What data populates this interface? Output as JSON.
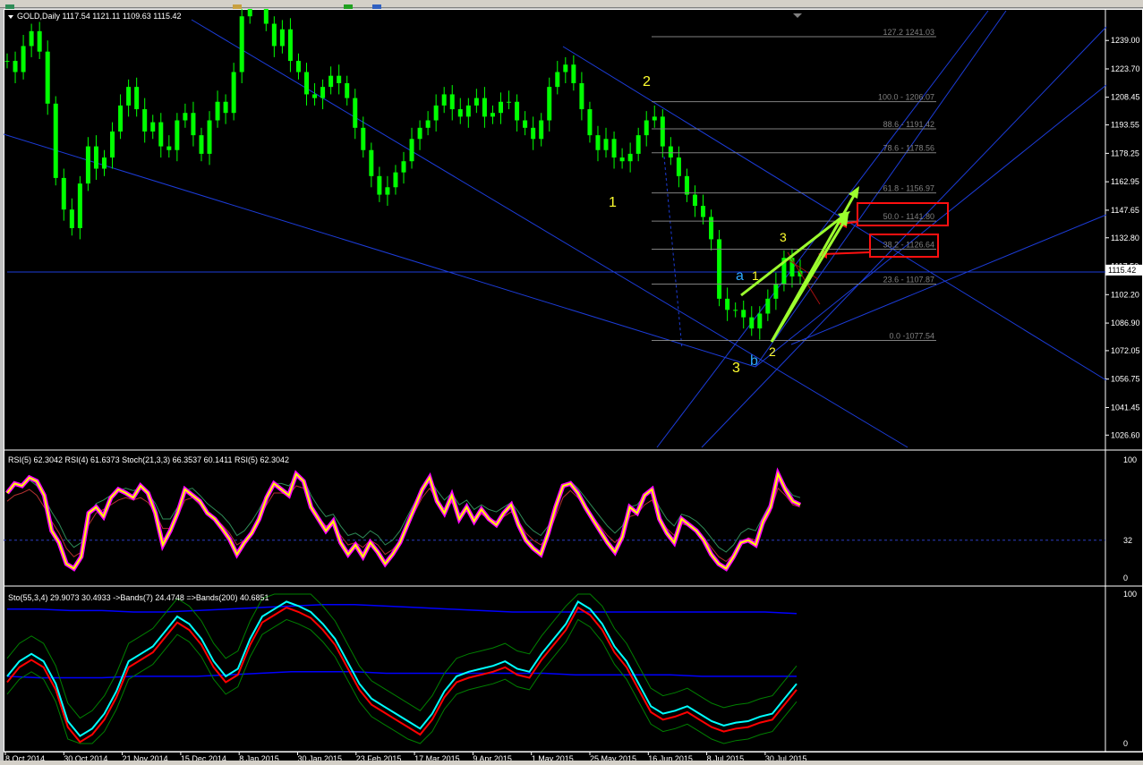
{
  "window": {
    "ohlc_header": "GOLD,Daily  1117.54 1121.11 1109.63 1115.42",
    "current_price": "1115.42"
  },
  "colors": {
    "background": "#000000",
    "candles": "#00ff00",
    "grid_line": "#1c3cd8",
    "fib_line": "#808080",
    "fib_text": "#808080",
    "elliott_yellow": "#ffff30",
    "elliott_blue": "#2ea8ff",
    "arrow_green": "#9cff2e",
    "arrow_red": "#ff1010",
    "rsi_yellow": "#ffff00",
    "rsi_magenta": "#ff00ff",
    "sto_cyan": "#00ffff",
    "sto_red": "#ff0000",
    "band_blue": "#0000ff",
    "band_green": "#008000"
  },
  "toolbar": {
    "icons": [
      "new-chart-icon",
      "zoom-icon",
      "add-icon",
      "globe-icon"
    ]
  },
  "chart_data": [
    {
      "type": "candlestick",
      "symbol": "GOLD",
      "timeframe": "Daily",
      "y_axis_ticks": [
        "1239.00",
        "1223.70",
        "1208.45",
        "1193.55",
        "1178.25",
        "1162.95",
        "1147.65",
        "1132.80",
        "1117.50",
        "1102.20",
        "1086.90",
        "1072.05",
        "1056.75",
        "1041.45",
        "1026.60"
      ],
      "ylim": [
        1020,
        1255
      ],
      "close_path": [
        1228,
        1222,
        1236,
        1244,
        1233,
        1205,
        1165,
        1148,
        1138,
        1162,
        1182,
        1170,
        1176,
        1190,
        1204,
        1214,
        1202,
        1190,
        1195,
        1182,
        1180,
        1196,
        1200,
        1188,
        1178,
        1196,
        1206,
        1200,
        1222,
        1252,
        1272,
        1264,
        1248,
        1236,
        1245,
        1228,
        1222,
        1210,
        1208,
        1214,
        1220,
        1216,
        1208,
        1192,
        1180,
        1166,
        1156,
        1160,
        1168,
        1174,
        1186,
        1192,
        1196,
        1204,
        1210,
        1202,
        1198,
        1204,
        1208,
        1198,
        1200,
        1206,
        1206,
        1196,
        1192,
        1186,
        1196,
        1214,
        1222,
        1226,
        1216,
        1202,
        1188,
        1180,
        1186,
        1176,
        1174,
        1178,
        1188,
        1196,
        1198,
        1182,
        1176,
        1166,
        1156,
        1150,
        1144,
        1132,
        1100,
        1094,
        1094,
        1090,
        1084,
        1092,
        1100,
        1108,
        1122,
        1112,
        1115
      ],
      "fibonacci": [
        {
          "level": "127.2",
          "price": "1241.03",
          "label": "127.2  1241.03"
        },
        {
          "level": "100.0",
          "price": "1206.07",
          "label": "100.0 - 1206.07"
        },
        {
          "level": "88.6",
          "price": "1191.42",
          "label": "88.6 - 1191.42"
        },
        {
          "level": "78.6",
          "price": "1178.56",
          "label": "78.6 - 1178.56"
        },
        {
          "level": "61.8",
          "price": "1156.97",
          "label": "61.8 - 1156.97"
        },
        {
          "level": "50.0",
          "price": "1141.80",
          "label": "50.0 - 1141.80"
        },
        {
          "level": "38.2",
          "price": "1126.64",
          "label": "38.2 - 1126.64"
        },
        {
          "level": "23.6",
          "price": "1107.87",
          "label": "23.6 - 1107.87"
        },
        {
          "level": "0.0",
          "price": "1077.54",
          "label": "0.0 -1077.54"
        }
      ],
      "wave_labels": [
        {
          "text": "2",
          "color": "yellow"
        },
        {
          "text": "1",
          "color": "yellow"
        },
        {
          "text": "3",
          "color": "yellow"
        },
        {
          "text": "a",
          "color": "blue"
        },
        {
          "text": "b",
          "color": "blue"
        },
        {
          "text": "1",
          "color": "yellow"
        },
        {
          "text": "2",
          "color": "yellow"
        },
        {
          "text": "3",
          "color": "yellow"
        }
      ]
    },
    {
      "type": "line",
      "panel": "RSI/Stoch",
      "legend": "RSI(5) 62.3042  RSI(4) 61.6373  Stoch(21,3,3) 66.3537 60.1411  RSI(5) 62.3042",
      "ylim": [
        0,
        100
      ],
      "y_ticks": [
        "100",
        "32",
        "0"
      ],
      "level_line": 32,
      "rsi": [
        72,
        80,
        78,
        85,
        82,
        70,
        40,
        30,
        12,
        8,
        18,
        55,
        60,
        52,
        68,
        75,
        72,
        68,
        78,
        72,
        55,
        28,
        40,
        55,
        75,
        70,
        65,
        55,
        50,
        42,
        33,
        20,
        30,
        38,
        50,
        68,
        80,
        75,
        70,
        88,
        82,
        60,
        50,
        40,
        48,
        30,
        20,
        28,
        18,
        30,
        22,
        12,
        20,
        30,
        45,
        60,
        75,
        85,
        65,
        55,
        70,
        50,
        60,
        48,
        58,
        50,
        45,
        55,
        62,
        45,
        32,
        25,
        20,
        38,
        60,
        78,
        80,
        72,
        60,
        50,
        40,
        30,
        22,
        35,
        60,
        55,
        70,
        75,
        50,
        38,
        30,
        50,
        45,
        40,
        32,
        20,
        12,
        8,
        18,
        30,
        32,
        28,
        48,
        60,
        88,
        75,
        65,
        62
      ],
      "sto": [
        65,
        70,
        72,
        75,
        70,
        60,
        48,
        38,
        25,
        18,
        22,
        45,
        55,
        58,
        62,
        66,
        68,
        66,
        68,
        64,
        55,
        42,
        42,
        52,
        66,
        68,
        62,
        55,
        50,
        45,
        38,
        28,
        32,
        40,
        50,
        62,
        72,
        72,
        70,
        78,
        76,
        62,
        52,
        44,
        46,
        36,
        28,
        30,
        26,
        32,
        28,
        20,
        24,
        32,
        44,
        56,
        68,
        76,
        66,
        58,
        64,
        54,
        58,
        50,
        54,
        50,
        48,
        52,
        56,
        48,
        38,
        32,
        28,
        36,
        52,
        68,
        74,
        68,
        60,
        52,
        44,
        36,
        30,
        36,
        52,
        54,
        62,
        66,
        52,
        42,
        36,
        46,
        44,
        40,
        34,
        26,
        18,
        14,
        20,
        30,
        34,
        32,
        44,
        56,
        76,
        70,
        62,
        60
      ]
    },
    {
      "type": "line",
      "panel": "Stochastic Bands",
      "legend": "Sto(55,3,4) 29.9073 30.4933  ->Bands(7) 24.4748  =>Bands(200) 40.6851",
      "ylim": [
        0,
        100
      ],
      "y_ticks": [
        "100",
        "0"
      ],
      "main": [
        45,
        55,
        60,
        55,
        40,
        15,
        5,
        10,
        20,
        35,
        55,
        60,
        65,
        75,
        85,
        80,
        70,
        55,
        45,
        50,
        70,
        85,
        90,
        95,
        92,
        88,
        80,
        70,
        55,
        40,
        30,
        25,
        20,
        15,
        10,
        20,
        35,
        45,
        48,
        50,
        52,
        55,
        50,
        48,
        60,
        70,
        80,
        95,
        90,
        80,
        65,
        55,
        40,
        25,
        20,
        22,
        25,
        20,
        15,
        12,
        14,
        15,
        18,
        20,
        30,
        40
      ],
      "upper_band": [
        90,
        90,
        89,
        89,
        88,
        88,
        89,
        90,
        91,
        92,
        93,
        93,
        92,
        91,
        90,
        89,
        88,
        88,
        88,
        88,
        88,
        88,
        88,
        88,
        88,
        87
      ],
      "lower_band": [
        45,
        44,
        44,
        44,
        45,
        45,
        45,
        46,
        47,
        48,
        48,
        48,
        47,
        47,
        47,
        47,
        47,
        47,
        46,
        46,
        46,
        46,
        45,
        45,
        45,
        45
      ]
    }
  ],
  "x_axis_dates": [
    "8 Oct 2014",
    "30 Oct 2014",
    "21 Nov 2014",
    "15 Dec 2014",
    "8 Jan 2015",
    "30 Jan 2015",
    "23 Feb 2015",
    "17 Mar 2015",
    "9 Apr 2015",
    "1 May 2015",
    "25 May 2015",
    "16 Jun 2015",
    "8 Jul 2015",
    "30 Jul 2015"
  ]
}
